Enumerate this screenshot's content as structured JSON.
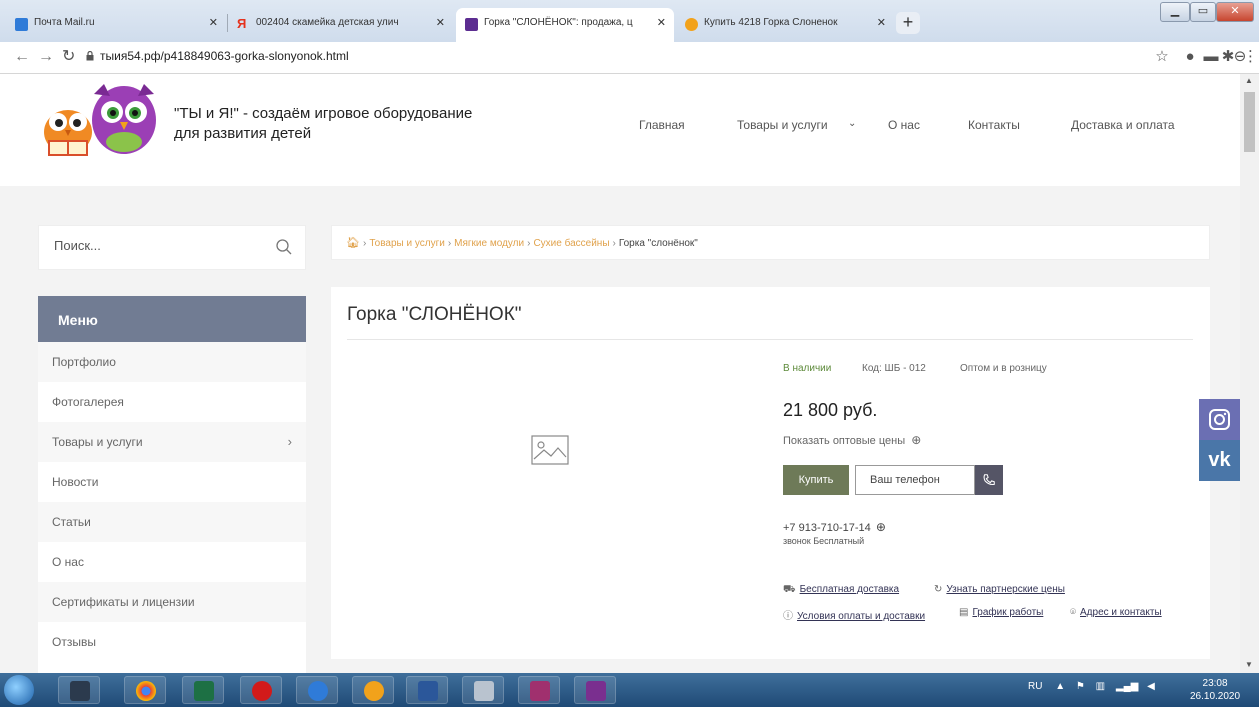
{
  "browser": {
    "tabs": [
      {
        "title": "Почта Mail.ru",
        "color": "#2f7bd8"
      },
      {
        "title": "002404 скамейка детская улич",
        "color": "#e5321d"
      },
      {
        "title": "Горка \"СЛОНЁНОК\": продажа, ц",
        "color": "#5c2d91"
      },
      {
        "title": "Купить 4218 Горка Слоненок",
        "color": "#f2a21b"
      }
    ],
    "url": "тыия54.рф/p418849063-gorka-slonyonok.html",
    "new_tab": "+"
  },
  "site": {
    "title_line1": "\"ТЫ и Я!\" - создаём игровое оборудование",
    "title_line2": "для развития детей",
    "nav": [
      "Главная",
      "Товары и услуги",
      "О нас",
      "Контакты",
      "Доставка и оплата"
    ]
  },
  "search": {
    "placeholder": "Поиск..."
  },
  "breadcrumb": {
    "items": [
      "Товары и услуги",
      "Мягкие модули",
      "Сухие бассейны"
    ],
    "current": "Горка \"слонёнок\"",
    "sep": "›"
  },
  "menu": {
    "title": "Меню",
    "items": [
      "Портфолио",
      "Фотогалерея",
      "Товары и услуги",
      "Новости",
      "Статьи",
      "О нас",
      "Сертификаты и лицензии",
      "Отзывы"
    ]
  },
  "product": {
    "title": "Горка \"СЛОНЁНОК\"",
    "stock": "В наличии",
    "code": "Код: ШБ - 012",
    "sale_type": "Оптом и в розницу",
    "price": "21 800 руб.",
    "wholesale_link": "Показать оптовые цены",
    "buy_label": "Купить",
    "phone_placeholder": "Ваш телефон",
    "contact_phone": "+7 913-710-17-14",
    "contact_note": "звонок Бесплатный",
    "links": [
      "Бесплатная доставка",
      "Узнать партнерские цены",
      "Условия оплаты и доставки",
      "График работы",
      "Адрес и контакты"
    ]
  },
  "taskbar": {
    "lang": "RU",
    "time": "23:08",
    "date": "26.10.2020"
  }
}
